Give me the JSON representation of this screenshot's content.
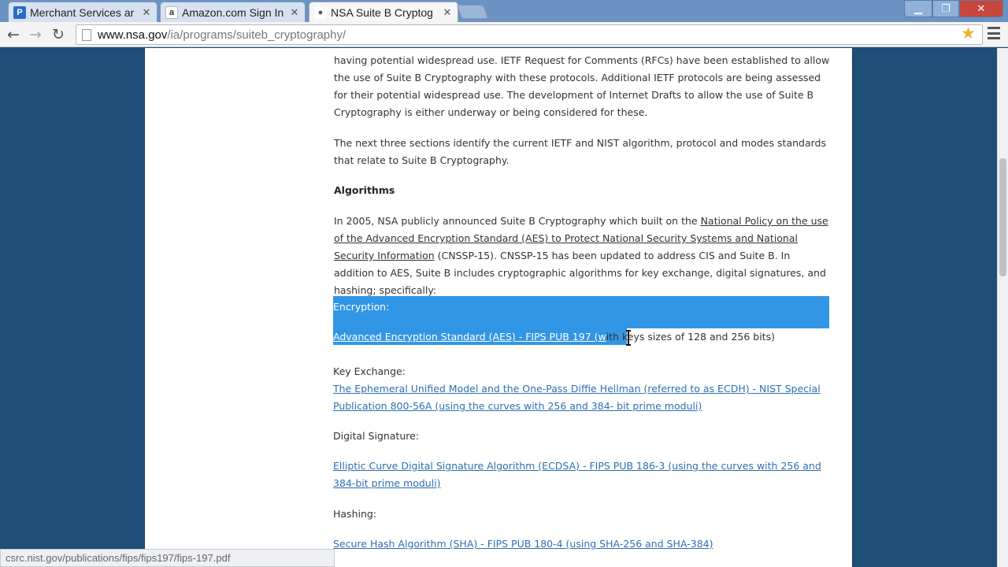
{
  "browser": {
    "tabs": [
      {
        "label": "Merchant Services ar",
        "favicon": "P",
        "favicon_color": "#2a6bc5"
      },
      {
        "label": "Amazon.com Sign In",
        "favicon": "a",
        "favicon_color": "#333333"
      },
      {
        "label": "NSA Suite B Cryptog",
        "favicon": "●",
        "favicon_color": "#555555"
      }
    ],
    "url_host": "www.nsa.gov",
    "url_path": "/ia/programs/suiteb_cryptography/",
    "status_url": "csrc.nist.gov/publications/fips/fips197/fips-197.pdf"
  },
  "article": {
    "p1": "having potential widespread use. IETF Request for Comments (RFCs) have been established to allow the use of Suite B Cryptography with these protocols.  Additional IETF protocols are being assessed for their potential widespread use.  The development of Internet Drafts to allow the use of Suite B Cryptography is either underway or being considered for these.",
    "p2": "The next three sections identify the current IETF and NIST algorithm, protocol and modes standards that relate to Suite B Cryptography.",
    "heading_algorithms": "Algorithms",
    "p3_before": "In 2005, NSA publicly announced Suite B Cryptography which built on the ",
    "p3_link": "National Policy on the use of the Advanced Encryption Standard (AES) to Protect National Security Systems and National Security Information",
    "p3_after": " (CNSSP-15). CNSSP-15 has been updated to address CIS and Suite B. In addition to AES, Suite B includes cryptographic algorithms for key exchange, digital signatures, and hashing; specifically:",
    "encryption_label": "Encryption:",
    "encryption_link": "Advanced Encryption Standard (AES) - FIPS PUB 197 (w",
    "encryption_rest": "ith keys sizes of 128 and 256 bits)",
    "key_exchange_label": "Key Exchange:",
    "key_exchange_link": "The Ephemeral Unified Model and the One-Pass Diffie Hellman (referred to as ECDH) - NIST Special Publication 800-56A (using the curves with 256 and 384- bit prime moduli)",
    "digital_signature_label": "Digital Signature:",
    "digital_signature_link": "Elliptic Curve Digital Signature Algorithm (ECDSA) - FIPS PUB 186-3 (using the curves with 256 and 384-bit prime moduli)",
    "hashing_label": "Hashing:",
    "hashing_link": "Secure Hash Algorithm (SHA) - FIPS PUB 180-4 (using SHA-256 and SHA-384)"
  },
  "colors": {
    "selection": "#3296e6",
    "link": "#2f6fb0",
    "page_background": "#1f4e79"
  }
}
